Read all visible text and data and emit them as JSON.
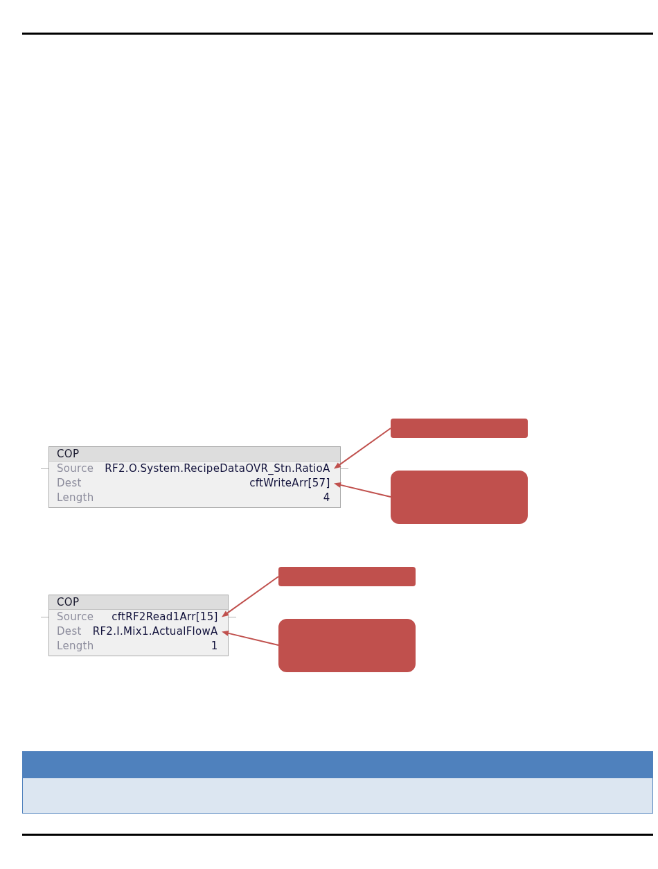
{
  "page_header": {
    "rule": true
  },
  "instructions": [
    {
      "mnemonic": "COP",
      "operands": [
        {
          "label": "Source",
          "value": "RF2.O.System.RecipeDataOVR_Stn.RatioA",
          "callout": true
        },
        {
          "label": "Dest",
          "value": "cftWriteArr[57]",
          "callout": true
        },
        {
          "label": "Length",
          "value": "4",
          "callout": false
        }
      ]
    },
    {
      "mnemonic": "COP",
      "operands": [
        {
          "label": "Source",
          "value": "cftRF2Read1Arr[15]",
          "callout": true
        },
        {
          "label": "Dest",
          "value": "RF2.I.Mix1.ActualFlowA",
          "callout": true
        },
        {
          "label": "Length",
          "value": "1",
          "callout": false
        }
      ]
    }
  ],
  "note_table": {
    "kind": "titled"
  },
  "page_footer": {
    "rule": true
  }
}
